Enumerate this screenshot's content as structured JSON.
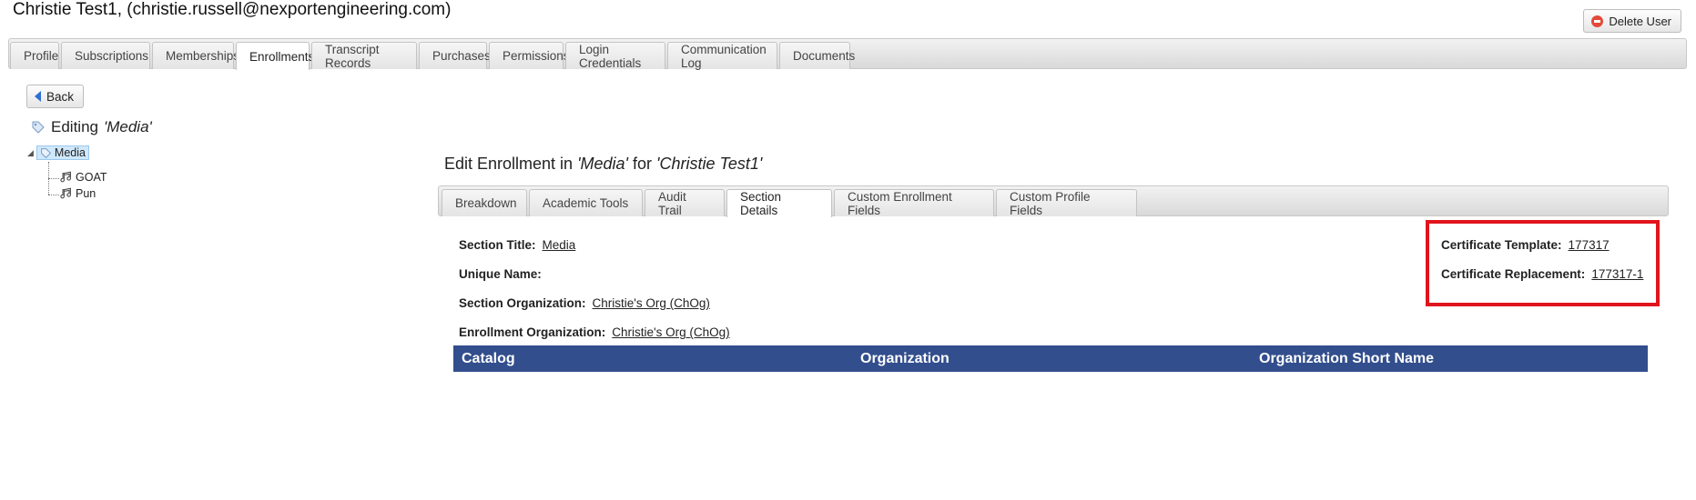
{
  "header": {
    "user_title": "Christie Test1, (christie.russell@nexportengineering.com)",
    "delete_label": "Delete User"
  },
  "main_tabs": [
    {
      "label": "Profile"
    },
    {
      "label": "Subscriptions"
    },
    {
      "label": "Memberships"
    },
    {
      "label": "Enrollments",
      "active": true
    },
    {
      "label": "Transcript Records"
    },
    {
      "label": "Purchases"
    },
    {
      "label": "Permissions"
    },
    {
      "label": "Login Credentials"
    },
    {
      "label": "Communication Log"
    },
    {
      "label": "Documents"
    }
  ],
  "back_label": "Back",
  "editing": {
    "prefix": "Editing",
    "name": "'Media'"
  },
  "tree": {
    "root": "Media",
    "children": [
      "GOAT",
      "Pun"
    ]
  },
  "edit_title": {
    "prefix": "Edit Enrollment in",
    "section": "'Media'",
    "middle": "for",
    "user": "'Christie Test1'"
  },
  "sub_tabs": [
    {
      "label": "Breakdown"
    },
    {
      "label": "Academic Tools"
    },
    {
      "label": "Audit Trail"
    },
    {
      "label": "Section Details",
      "active": true
    },
    {
      "label": "Custom Enrollment Fields"
    },
    {
      "label": "Custom Profile Fields"
    }
  ],
  "details": {
    "section_title": {
      "label": "Section Title:",
      "value": "Media"
    },
    "unique_name": {
      "label": "Unique Name:",
      "value": ""
    },
    "section_org": {
      "label": "Section Organization:",
      "value": "Christie's Org (ChOg)"
    },
    "enrollment_org": {
      "label": "Enrollment Organization:",
      "value": "Christie's Org (ChOg)"
    },
    "cert_template": {
      "label": "Certificate Template:",
      "value": "177317"
    },
    "cert_replacement": {
      "label": "Certificate Replacement:",
      "value": "177317-1"
    }
  },
  "table": {
    "columns": [
      "Catalog",
      "Organization",
      "Organization Short Name"
    ]
  },
  "colors": {
    "highlight_box": "#e0141c",
    "table_header": "#324e8c"
  }
}
